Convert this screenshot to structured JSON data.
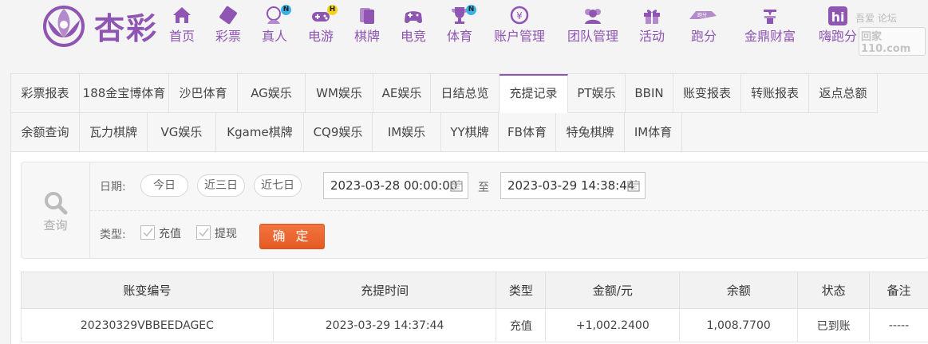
{
  "brand": {
    "name": "杏彩",
    "accent": "#8f55b2"
  },
  "nav": [
    {
      "label": "首页",
      "icon": "home-icon"
    },
    {
      "label": "彩票",
      "icon": "ticket-icon"
    },
    {
      "label": "真人",
      "icon": "dealer-icon",
      "badge": "N"
    },
    {
      "label": "电游",
      "icon": "gamepad-icon",
      "badge": "H"
    },
    {
      "label": "棋牌",
      "icon": "cards-icon"
    },
    {
      "label": "电竞",
      "icon": "controller-icon"
    },
    {
      "label": "体育",
      "icon": "trophy-icon",
      "badge": "N"
    },
    {
      "label": "账户管理",
      "icon": "yen-coin-icon"
    },
    {
      "label": "团队管理",
      "icon": "team-icon"
    },
    {
      "label": "活动",
      "icon": "gift-icon"
    },
    {
      "label": "跑分",
      "icon": "run-score-icon"
    },
    {
      "label": "金鼎财富",
      "icon": "wealth-icon"
    },
    {
      "label": "嗨跑分",
      "icon": "hi-app-icon"
    }
  ],
  "watermark": {
    "line1": "吾爱  论坛",
    "line2": "回家110.com"
  },
  "tabs_row1": [
    "彩票报表",
    "188金宝博体育",
    "沙巴体育",
    "AG娱乐",
    "WM娱乐",
    "AE娱乐",
    "日结总览",
    "充提记录",
    "PT娱乐",
    "BBIN",
    "账变报表",
    "转账报表",
    "返点总额"
  ],
  "tabs_row2": [
    "余额查询",
    "瓦力棋牌",
    "VG娱乐",
    "Kgame棋牌",
    "CQ9娱乐",
    "IM娱乐",
    "YY棋牌",
    "FB体育",
    "特兔棋牌",
    "IM体育"
  ],
  "active_tab": "充提记录",
  "query": {
    "side_label": "查询",
    "date_label": "日期:",
    "quick": [
      "今日",
      "近三日",
      "近七日"
    ],
    "start": "2023-03-28 00:00:00",
    "to": "至",
    "end": "2023-03-29 14:38:44",
    "type_label": "类型:",
    "types": [
      "充值",
      "提现"
    ],
    "confirm": "确 定"
  },
  "table": {
    "headers": [
      "账变编号",
      "充提时间",
      "类型",
      "金额/元",
      "余额",
      "状态",
      "备注"
    ],
    "rows": [
      [
        "20230329VBBEEDAGEC",
        "2023-03-29 14:37:44",
        "充值",
        "+1,002.2400",
        "1,008.7700",
        "已到账",
        "-----"
      ]
    ]
  }
}
